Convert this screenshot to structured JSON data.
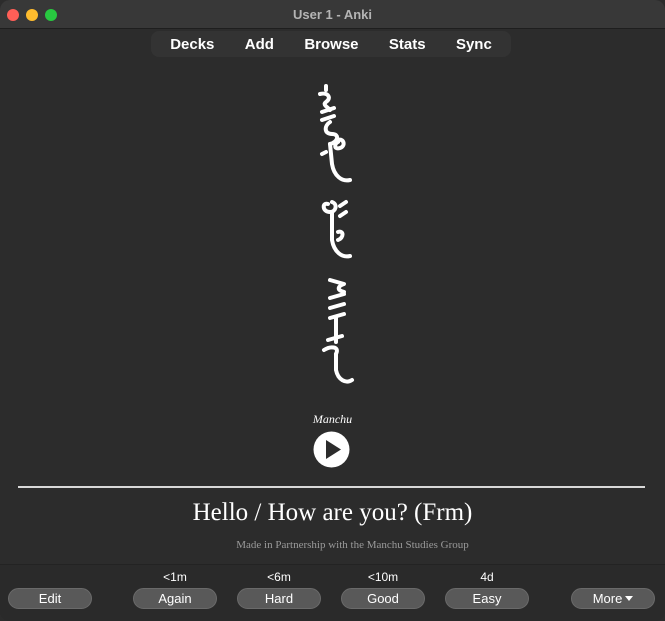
{
  "window": {
    "title": "User 1 - Anki"
  },
  "toolbar": {
    "items": [
      {
        "label": "Decks"
      },
      {
        "label": "Add"
      },
      {
        "label": "Browse"
      },
      {
        "label": "Stats"
      },
      {
        "label": "Sync"
      }
    ]
  },
  "card": {
    "audio_label": "Manchu",
    "answer": "Hello / How are you? (Frm)",
    "credit": "Made in Partnership with the Manchu Studies Group"
  },
  "bottombar": {
    "edit_label": "Edit",
    "more_label": "More",
    "answers": [
      {
        "label": "Again",
        "interval": "<1m"
      },
      {
        "label": "Hard",
        "interval": "<6m"
      },
      {
        "label": "Good",
        "interval": "<10m"
      },
      {
        "label": "Easy",
        "interval": "4d"
      }
    ]
  },
  "colors": {
    "background": "#2c2c2c",
    "button": "#595959",
    "close": "#ff5f57",
    "minimize": "#febc2e",
    "maximize": "#28c840"
  },
  "icons": {
    "play": "play-circle-icon",
    "more": "chevron-down-icon"
  }
}
